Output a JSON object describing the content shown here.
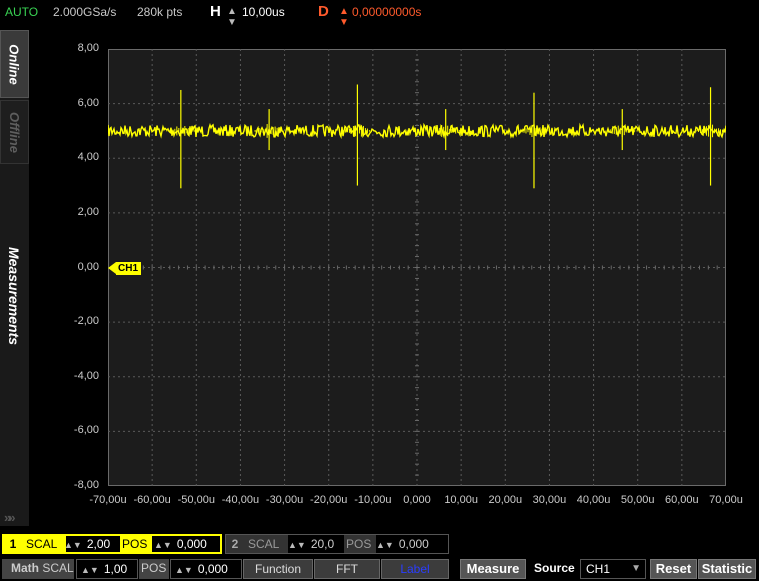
{
  "status": {
    "mode": "AUTO",
    "sample_rate": "2.000GSa/s",
    "points": "280k pts",
    "h_label": "H",
    "h_value": "10,00us",
    "d_label": "D",
    "d_value": "0,00000000s"
  },
  "sidebar": {
    "tabs": [
      {
        "label": "Online"
      },
      {
        "label": "Offline"
      },
      {
        "label": "Measurements"
      }
    ],
    "expand_glyph": "»»"
  },
  "plot": {
    "y_ticks": [
      "8,00",
      "6,00",
      "4,00",
      "2,00",
      "0,00",
      "-2,00",
      "-4,00",
      "-6,00",
      "-8,00"
    ],
    "x_ticks": [
      "-70,00u",
      "-60,00u",
      "-50,00u",
      "-40,00u",
      "-30,00u",
      "-20,00u",
      "-10,00u",
      "0,000",
      "10,00u",
      "20,00u",
      "30,00u",
      "40,00u",
      "50,00u",
      "60,00u",
      "70,00u"
    ],
    "ch1_marker": "CH1",
    "trace_color": "#ffff00",
    "grid_color": "#5a5a5a",
    "background": "#1c1c1c"
  },
  "chart_data": {
    "type": "line",
    "title": "",
    "xlabel": "",
    "ylabel": "",
    "xlim": [
      -70,
      70
    ],
    "ylim": [
      -8,
      8
    ],
    "grid": true,
    "series": [
      {
        "baseline": 5.0,
        "noise": 0.1,
        "spikes": [
          {
            "x": -53.5,
            "ymax": 6.5,
            "ymin": 2.9
          },
          {
            "x": -33.5,
            "ymax": 5.8,
            "ymin": 4.3
          },
          {
            "x": -13.5,
            "ymax": 6.7,
            "ymin": 3.0
          },
          {
            "x": 6.5,
            "ymax": 5.8,
            "ymin": 4.3
          },
          {
            "x": 26.5,
            "ymax": 6.4,
            "ymin": 2.9
          },
          {
            "x": 46.5,
            "ymax": 5.8,
            "ymin": 4.3
          },
          {
            "x": 66.5,
            "ymax": 6.6,
            "ymin": 3.0
          }
        ]
      }
    ]
  },
  "bottom": {
    "ch1": {
      "num": "1",
      "scal_label": "SCAL",
      "scal_value": "2,00",
      "pos_label": "POS",
      "pos_value": "0,000"
    },
    "ch2": {
      "num": "2",
      "scal_label": "SCAL",
      "scal_value": "20,0",
      "pos_label": "POS",
      "pos_value": "0,000"
    },
    "math": {
      "label": "Math",
      "scal_label": "SCAL",
      "scal_value": "1,00",
      "pos_label": "POS",
      "pos_value": "0,000"
    },
    "function_label": "Function",
    "fft_label": "FFT",
    "label_label": "Label",
    "measure_label": "Measure",
    "source_label": "Source",
    "source_value": "CH1",
    "reset_label": "Reset",
    "statistic_label": "Statistic"
  }
}
